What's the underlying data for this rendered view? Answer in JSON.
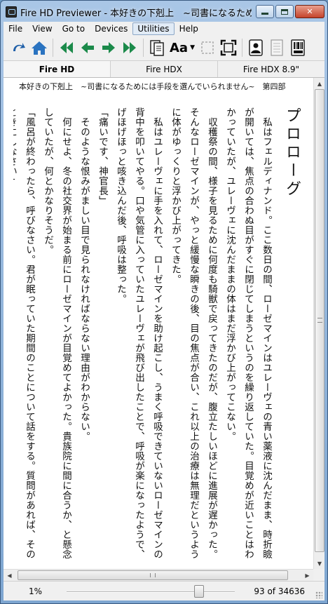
{
  "window": {
    "title": "Fire HD Previewer - 本好きの下剋上　~司書になるため..."
  },
  "menu": {
    "items": [
      "File",
      "View",
      "Go to",
      "Devices",
      "Utilities",
      "Help"
    ]
  },
  "toolbar": {
    "icons": [
      "rotate-icon",
      "home-icon",
      "first-page-icon",
      "previous-page-icon",
      "next-page-icon",
      "last-page-icon",
      "page-view-icon",
      "font-size-icon",
      "fit-icon",
      "fullscreen-icon",
      "portrait-icon",
      "document-icon",
      "barcode-icon"
    ],
    "font_label": "Aa"
  },
  "device_tabs": [
    "Fire HD",
    "Fire HDX",
    "Fire HDX 8.9\""
  ],
  "book": {
    "header": "本好きの下剋上　~司書になるためには手段を選んでいられません~　第四部",
    "chapter_title": "プロローグ",
    "paragraphs": [
      "私はフェルディナンド。ここ数日の間、ローゼマインはユレーヴェの青い薬液に沈んだまま、時折瞼が開いては、焦点の合わぬ目がすぐに閉じてしまうというのを繰り返していた。目覚めが近いことはわかっていたが、ユレーヴェに沈んだままの体はまだ浮かび上がってこない。",
      "収穫祭の間、様子を見るために何度も騎獣で戻ってきたのだが、腹立たしいほどに進展が遅かった。そんなローゼマインが、やっと緩慢な瞬きの後、目の焦点が合い、これ以上の治療は無理だというように体がゆっくりと浮かび上がってきた。",
      "私はユレーヴェに手を入れて、ローゼマインを助け起こし、うまく呼吸できていないローゼマインの背中を叩いてやる。口や気管に入っていたユレーヴェが飛び出したことで、呼吸が楽になったようで、げほげほっと咳き込んだ後、呼吸は整った。",
      "「痛いです、神官長」",
      "そのような恨みがましい目で見られなければならない理由がわからない。",
      "何にせよ、冬の社交界が始まる前にローゼマインが目覚めてよかった。貴族院に間に合うか、と懸念していたが、何とかなりそうだ。",
      "「風呂が終わったら、呼びなさい。君が眠っていた期間のことについて話をする。質問があれば、そのときにしなさい」"
    ]
  },
  "status": {
    "zoom": "1%",
    "position": "93 of 34636",
    "progress_fraction": 0.0027
  }
}
